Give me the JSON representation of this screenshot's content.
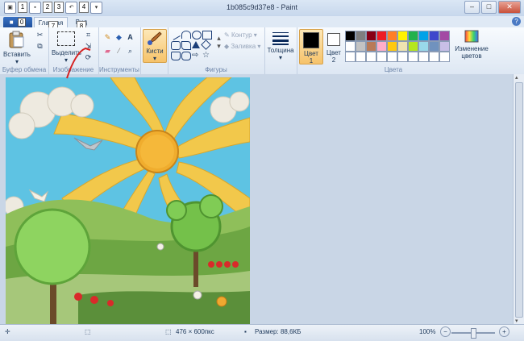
{
  "window": {
    "title": "1b085c9d37e8 - Paint",
    "quick_access": [
      "1",
      "2",
      "3",
      "4"
    ],
    "file_tab_number": "0"
  },
  "tabs": {
    "file": "■",
    "home": "Главная",
    "view": "Вид",
    "home_number": "7",
    "view_number": "8",
    "help": "?"
  },
  "ribbon": {
    "clipboard": {
      "label": "Буфер обмена",
      "paste": "Вставить"
    },
    "image": {
      "label": "Изображение",
      "select": "Выделить"
    },
    "tools": {
      "label": "Инструменты"
    },
    "brushes": {
      "label": "Кисти"
    },
    "shapes": {
      "label": "Фигуры",
      "outline": "Контур",
      "fill": "Заливка"
    },
    "size": {
      "label": "Толщина"
    },
    "colors": {
      "label": "Цвета",
      "color1": "Цвет 1",
      "color1_line1": "Цвет",
      "color1_line2": "1",
      "color2_line1": "Цвет",
      "color2_line2": "2",
      "edit": "Изменение цветов",
      "edit_line1": "Изменение",
      "edit_line2": "цветов",
      "color1_value": "#000000",
      "color2_value": "#ffffff"
    }
  },
  "palette": [
    "#000000",
    "#7f7f7f",
    "#880015",
    "#ed1c24",
    "#ff7f27",
    "#fff200",
    "#22b14c",
    "#00a2e8",
    "#3f48cc",
    "#a349a4",
    "#ffffff",
    "#c3c3c3",
    "#b97a57",
    "#ffaec9",
    "#ffc90e",
    "#efe4b0",
    "#b5e61d",
    "#99d9ea",
    "#7092be",
    "#c8bfe7",
    "#ffffff",
    "#ffffff",
    "#ffffff",
    "#ffffff",
    "#ffffff",
    "#ffffff",
    "#ffffff",
    "#ffffff",
    "#ffffff",
    "#ffffff"
  ],
  "status": {
    "dimensions": "476 × 600пкс",
    "size": "Размер: 88,6КБ",
    "zoom": "100%"
  }
}
